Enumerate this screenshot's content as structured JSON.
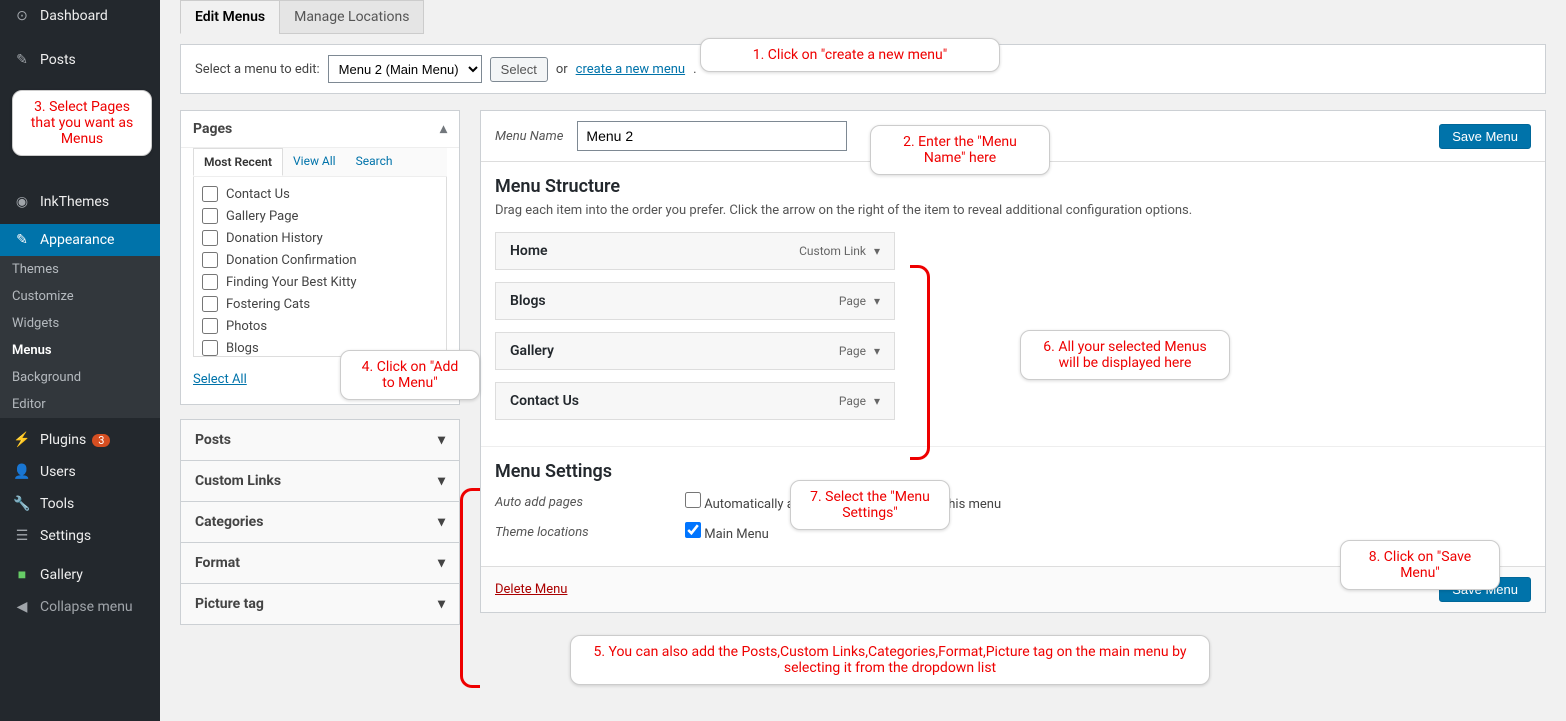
{
  "sidebar": {
    "items": [
      {
        "label": "Dashboard",
        "icon": "⌂"
      },
      {
        "label": "Posts",
        "icon": "📌"
      },
      {
        "label": "InkThemes",
        "icon": "◎"
      },
      {
        "label": "Appearance",
        "icon": "🖌",
        "active": true,
        "sub": [
          {
            "label": "Themes"
          },
          {
            "label": "Customize"
          },
          {
            "label": "Widgets"
          },
          {
            "label": "Menus",
            "active": true
          },
          {
            "label": "Background"
          },
          {
            "label": "Editor"
          }
        ]
      },
      {
        "label": "Plugins",
        "icon": "🔌",
        "badge": "3"
      },
      {
        "label": "Users",
        "icon": "👤"
      },
      {
        "label": "Tools",
        "icon": "🔧"
      },
      {
        "label": "Settings",
        "icon": "⚙"
      },
      {
        "label": "Gallery",
        "icon": "■"
      }
    ],
    "collapse": "Collapse menu"
  },
  "tabs": {
    "edit": "Edit Menus",
    "manage": "Manage Locations"
  },
  "select_bar": {
    "label": "Select a menu to edit:",
    "menu": "Menu 2 (Main Menu)",
    "select_btn": "Select",
    "or": "or",
    "create_link": "create a new menu",
    "period": "."
  },
  "pages_box": {
    "title": "Pages",
    "tabs": {
      "recent": "Most Recent",
      "view_all": "View All",
      "search": "Search"
    },
    "items": [
      "Contact Us",
      "Gallery Page",
      "Donation History",
      "Donation Confirmation",
      "Finding Your Best Kitty",
      "Fostering Cats",
      "Photos",
      "Blogs"
    ],
    "select_all": "Select All",
    "add": "Add to Menu"
  },
  "accordions": [
    "Posts",
    "Custom Links",
    "Categories",
    "Format",
    "Picture tag"
  ],
  "menu_edit": {
    "name_label": "Menu Name",
    "name_value": "Menu 2",
    "save": "Save Menu",
    "structure_title": "Menu Structure",
    "structure_hint": "Drag each item into the order you prefer. Click the arrow on the right of the item to reveal additional configuration options.",
    "items": [
      {
        "label": "Home",
        "type": "Custom Link"
      },
      {
        "label": "Blogs",
        "type": "Page"
      },
      {
        "label": "Gallery",
        "type": "Page"
      },
      {
        "label": "Contact Us",
        "type": "Page"
      }
    ],
    "settings_title": "Menu Settings",
    "auto_label": "Auto add pages",
    "auto_check": "Automatically add new top-level pages to this menu",
    "theme_label": "Theme locations",
    "theme_check": "Main Menu",
    "delete": "Delete Menu"
  },
  "callouts": {
    "c1": "1. Click on \"create a new menu\"",
    "c2": "2. Enter the \"Menu Name\" here",
    "c3": "3. Select Pages that you want as Menus",
    "c4": "4. Click on \"Add to Menu\"",
    "c5": "5. You can also add the Posts,Custom Links,Categories,Format,Picture tag on the main menu by selecting it from the dropdown list",
    "c6": "6. All your selected Menus will be displayed here",
    "c7": "7. Select the \"Menu Settings\"",
    "c8": "8. Click on \"Save Menu\""
  }
}
